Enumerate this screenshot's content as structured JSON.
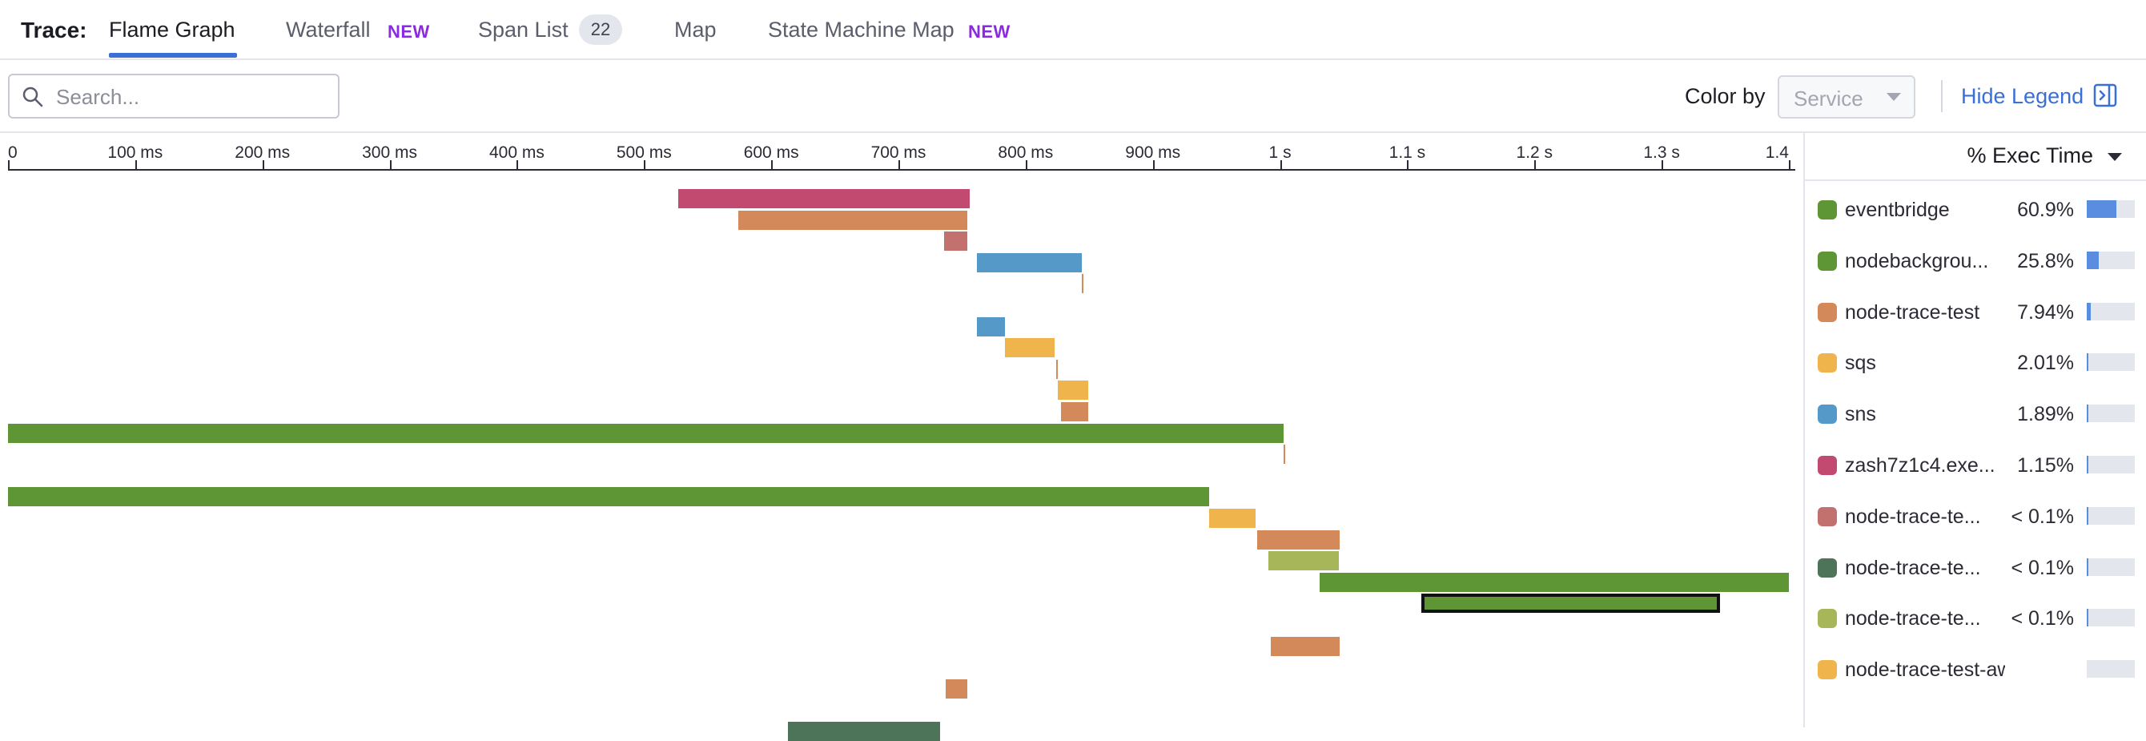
{
  "tabs": {
    "trace_label": "Trace:",
    "items": [
      {
        "label": "Flame Graph",
        "active": true
      },
      {
        "label": "Waterfall",
        "badge": "NEW"
      },
      {
        "label": "Span List",
        "count": "22"
      },
      {
        "label": "Map"
      },
      {
        "label": "State Machine Map",
        "badge": "NEW"
      }
    ]
  },
  "search": {
    "placeholder": "Search...",
    "value": ""
  },
  "color_by": {
    "label": "Color by",
    "selected": "Service"
  },
  "hide_legend": {
    "label": "Hide Legend"
  },
  "axis": {
    "max_ms": 1400,
    "ticks": [
      {
        "ms": 0,
        "label": "0"
      },
      {
        "ms": 100,
        "label": "100 ms"
      },
      {
        "ms": 200,
        "label": "200 ms"
      },
      {
        "ms": 300,
        "label": "300 ms"
      },
      {
        "ms": 400,
        "label": "400 ms"
      },
      {
        "ms": 500,
        "label": "500 ms"
      },
      {
        "ms": 600,
        "label": "600 ms"
      },
      {
        "ms": 700,
        "label": "700 ms"
      },
      {
        "ms": 800,
        "label": "800 ms"
      },
      {
        "ms": 900,
        "label": "900 ms"
      },
      {
        "ms": 1000,
        "label": "1 s"
      },
      {
        "ms": 1100,
        "label": "1.1 s"
      },
      {
        "ms": 1200,
        "label": "1.2 s"
      },
      {
        "ms": 1300,
        "label": "1.3 s"
      },
      {
        "ms": 1400,
        "label": "1.4"
      }
    ]
  },
  "spans": [
    {
      "start": 527,
      "end": 756,
      "row": 0,
      "color": "#c2496f"
    },
    {
      "start": 574,
      "end": 754,
      "row": 1,
      "color": "#d4895a"
    },
    {
      "start": 736,
      "end": 754,
      "row": 2,
      "color": "#c2716f"
    },
    {
      "start": 762,
      "end": 844,
      "row": 3,
      "color": "#5499c8"
    },
    {
      "start": 844,
      "end": 845,
      "row": 4,
      "color": "#d4895a"
    },
    {
      "start": 762,
      "end": 784,
      "row": 6,
      "color": "#5499c8"
    },
    {
      "start": 784,
      "end": 823,
      "row": 7,
      "color": "#f0b44c"
    },
    {
      "start": 824,
      "end": 825,
      "row": 8,
      "color": "#d4895a"
    },
    {
      "start": 825,
      "end": 849,
      "row": 9,
      "color": "#f0b44c"
    },
    {
      "start": 828,
      "end": 849,
      "row": 10,
      "color": "#d4895a"
    },
    {
      "start": 0,
      "end": 1003,
      "row": 11,
      "color": "#5e9535"
    },
    {
      "start": 1003,
      "end": 1004,
      "row": 12,
      "color": "#d4895a"
    },
    {
      "start": 0,
      "end": 944,
      "row": 14,
      "color": "#5e9535"
    },
    {
      "start": 944,
      "end": 981,
      "row": 15,
      "color": "#f0b44c"
    },
    {
      "start": 982,
      "end": 1047,
      "row": 16,
      "color": "#d4895a"
    },
    {
      "start": 991,
      "end": 1046,
      "row": 17,
      "color": "#a8b65a"
    },
    {
      "start": 1031,
      "end": 1400,
      "row": 18,
      "color": "#5e9535"
    },
    {
      "start": 1111,
      "end": 1346,
      "row": 19,
      "color": "#5e9535",
      "selected": true
    },
    {
      "start": 993,
      "end": 1047,
      "row": 21,
      "color": "#d4895a"
    },
    {
      "start": 737,
      "end": 754,
      "row": 23,
      "color": "#d4895a"
    },
    {
      "start": 613,
      "end": 733,
      "row": 25,
      "color": "#4d7359"
    }
  ],
  "legend": {
    "header": "% Exec Time",
    "items": [
      {
        "name": "eventbridge",
        "pct": "60.9%",
        "value": 60.9,
        "color": "#5e9535"
      },
      {
        "name": "nodebackgrou...",
        "pct": "25.8%",
        "value": 25.8,
        "color": "#5e9535"
      },
      {
        "name": "node-trace-test",
        "pct": "7.94%",
        "value": 7.94,
        "color": "#d4895a"
      },
      {
        "name": "sqs",
        "pct": "2.01%",
        "value": 2.01,
        "color": "#f0b44c"
      },
      {
        "name": "sns",
        "pct": "1.89%",
        "value": 1.89,
        "color": "#5499c8"
      },
      {
        "name": "zash7z1c4.exe...",
        "pct": "1.15%",
        "value": 1.15,
        "color": "#c2496f"
      },
      {
        "name": "node-trace-te...",
        "pct": "< 0.1%",
        "value": 0.05,
        "color": "#c2716f"
      },
      {
        "name": "node-trace-te...",
        "pct": "< 0.1%",
        "value": 0.05,
        "color": "#4d7359"
      },
      {
        "name": "node-trace-te...",
        "pct": "< 0.1%",
        "value": 0.05,
        "color": "#a8b65a"
      },
      {
        "name": "node-trace-test-aws-...",
        "pct": "",
        "value": 0,
        "color": "#f0b44c"
      }
    ]
  }
}
